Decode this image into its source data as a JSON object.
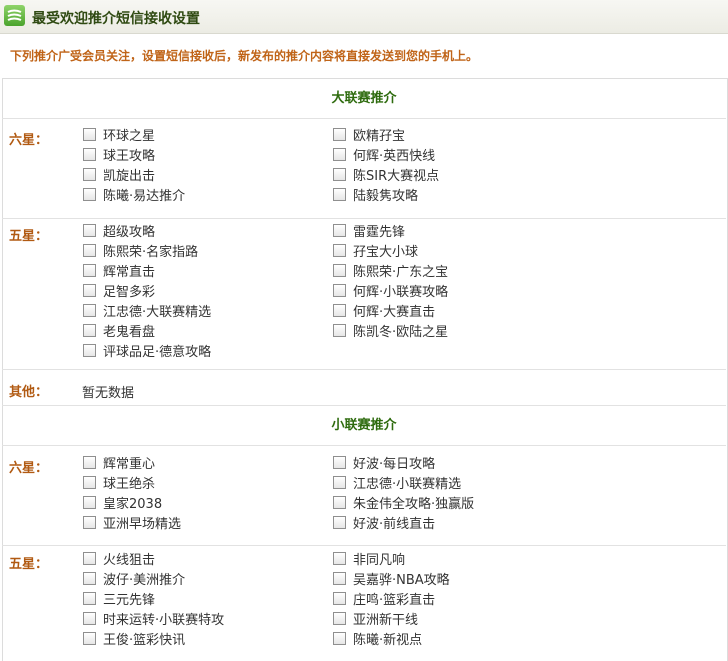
{
  "header": {
    "title": "最受欢迎推介短信接收设置",
    "icon": "sms-icon"
  },
  "notice": "下列推介广受会员关注，设置短信接收后，新发布的推介内容将直接发送到您的手机上。",
  "sections": [
    {
      "title": "大联赛推介",
      "groups": [
        {
          "label": "六星：",
          "left": [
            "环球之星",
            "球王攻略",
            "凯旋出击",
            "陈曦·易达推介"
          ],
          "right": [
            "欧精孖宝",
            "何辉·英西快线",
            "陈SIR大赛视点",
            "陆毅隽攻略"
          ]
        },
        {
          "label": "五星：",
          "left": [
            "超级攻略",
            "陈熙荣·名家指路",
            "辉常直击",
            "足智多彩",
            "江忠德·大联赛精选",
            "老鬼看盘",
            "评球品足·德意攻略"
          ],
          "right": [
            "雷霆先锋",
            "孖宝大小球",
            "陈熙荣·广东之宝",
            "何辉·小联赛攻略",
            "何辉·大赛直击",
            "陈凯冬·欧陆之星"
          ]
        },
        {
          "label": "其他：",
          "empty": "暂无数据"
        }
      ]
    },
    {
      "title": "小联赛推介",
      "groups": [
        {
          "label": "六星：",
          "left": [
            "辉常重心",
            "球王绝杀",
            "皇家2038",
            "亚洲早场精选"
          ],
          "right": [
            "好波·每日攻略",
            "江忠德·小联赛精选",
            "朱金伟全攻略·独赢版",
            "好波·前线直击"
          ]
        },
        {
          "label": "五星：",
          "left": [
            "火线狙击",
            "波仔·美洲推介",
            "三元先锋",
            "时来运转·小联赛特攻",
            "王俊·篮彩快讯"
          ],
          "right": [
            "非同凡响",
            "吴嘉骅·NBA攻略",
            "庄鸣·篮彩直击",
            "亚洲新干线",
            "陈曦·新视点"
          ]
        }
      ]
    }
  ]
}
